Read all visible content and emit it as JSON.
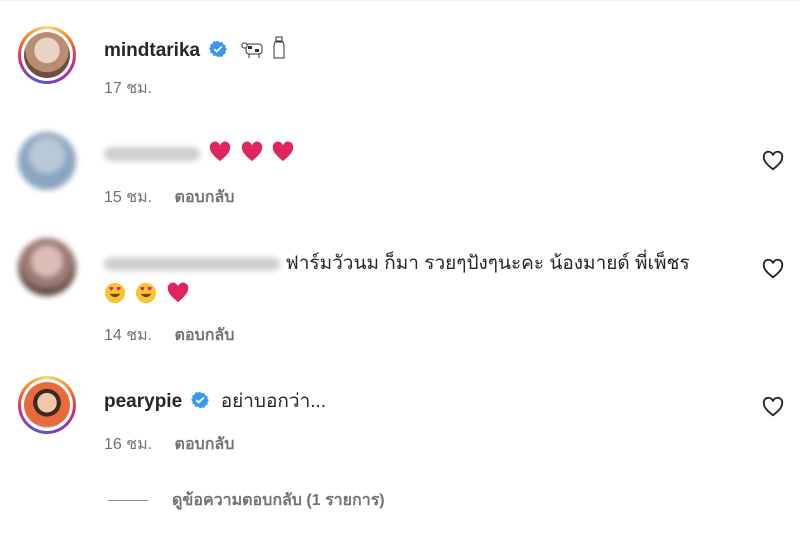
{
  "post": {
    "username": "mindtarika",
    "caption_emoji": [
      "cow-icon",
      "milk-bottle-icon"
    ],
    "time": "17 ชม."
  },
  "comments": [
    {
      "username": "",
      "text": "",
      "emoji": [
        "red-heart",
        "red-heart",
        "red-heart"
      ],
      "time": "15 ชม.",
      "reply_label": "ตอบกลับ"
    },
    {
      "username": "",
      "text": "ฟาร์มวัวนม ก็มา รวยๆปังๆนะคะ น้องมายด์ พี่เพ็ชร",
      "emoji": [
        "heart-eyes",
        "heart-eyes",
        "red-heart"
      ],
      "time": "14 ชม.",
      "reply_label": "ตอบกลับ"
    },
    {
      "username": "pearypie",
      "text": "อย่าบอกว่า...",
      "time": "16 ชม.",
      "reply_label": "ตอบกลับ"
    }
  ],
  "view_replies": "ดูข้อความตอบกลับ (1 รายการ)",
  "colors": {
    "verified": "#3897f0",
    "heart": "#e0245e",
    "muted": "#737373"
  }
}
